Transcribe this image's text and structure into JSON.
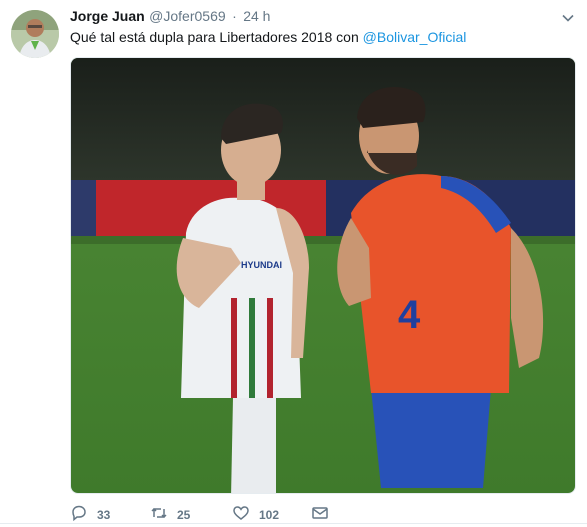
{
  "tweet": {
    "author_name": "Jorge Juan",
    "author_handle": "@Jofer0569",
    "separator": "·",
    "time": "24 h",
    "text_before": "Qué tal está dupla para Libertadores 2018 con ",
    "mention": "@Bolivar_Oficial"
  },
  "jersey": {
    "left_sponsor": "HYUNDAI",
    "right_number": "4"
  },
  "actions": {
    "reply_count": "33",
    "retweet_count": "25",
    "like_count": "102"
  },
  "icons": {
    "avatar": "avatar",
    "caret": "chevron-down-icon",
    "reply": "reply-icon",
    "retweet": "retweet-icon",
    "like": "heart-icon",
    "message": "envelope-icon"
  },
  "colors": {
    "link": "#1b95e0",
    "muted": "#657786",
    "text": "#14171a"
  }
}
